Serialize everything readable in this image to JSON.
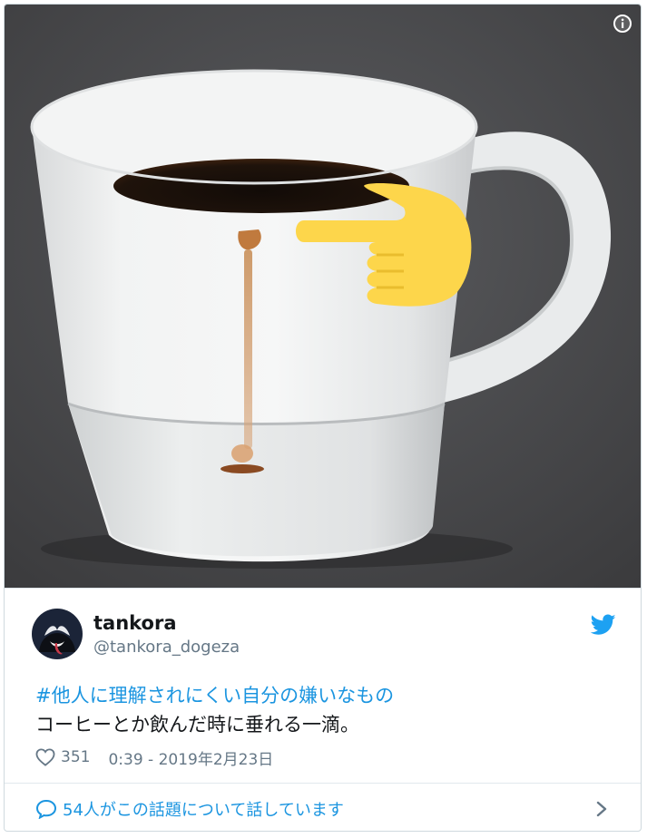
{
  "tweet": {
    "display_name": "tankora",
    "handle": "@tankora_dogeza",
    "hashtag": "#他人に理解されにくい自分の嫌いなもの",
    "body": "コーヒーとか飲んだ時に垂れる一滴。",
    "likes": "351",
    "timestamp": "0:39 - 2019年2月23日",
    "conversation": "54人がこの話題について話しています"
  },
  "icons": {
    "info": "info-icon",
    "verified_source": "twitter-bird-icon",
    "like": "heart-icon",
    "reply": "speech-bubble-icon",
    "more": "chevron-right-icon"
  },
  "colors": {
    "accent": "#1b95e0",
    "text": "#14171a",
    "muted": "#657786",
    "pointer": "#fdd64b"
  }
}
